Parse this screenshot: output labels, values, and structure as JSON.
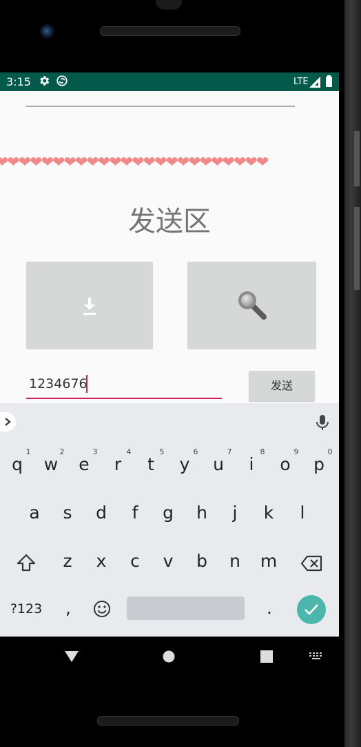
{
  "status_bar": {
    "time": "3:15",
    "network": "LTE"
  },
  "app": {
    "decoration": "❤❤❤❤❤❤❤❤❤❤❤❤❤❤❤❤❤❤❤❤❤❤❤❤",
    "title": "发送区",
    "input": {
      "value": "1234676"
    },
    "send_label": "发送",
    "buttons": {
      "download_icon": "download-icon",
      "search_icon": "search-icon"
    }
  },
  "keyboard": {
    "row1": [
      "q",
      "w",
      "e",
      "r",
      "t",
      "y",
      "u",
      "i",
      "o",
      "p"
    ],
    "row1_hints": [
      "1",
      "2",
      "3",
      "4",
      "5",
      "6",
      "7",
      "8",
      "9",
      "0"
    ],
    "row2": [
      "a",
      "s",
      "d",
      "f",
      "g",
      "h",
      "j",
      "k",
      "l"
    ],
    "row3": [
      "z",
      "x",
      "c",
      "v",
      "b",
      "n",
      "m"
    ],
    "symbols_label": "?123",
    "comma": ",",
    "period": ".",
    "emoji_icon": "emoji-icon",
    "enter_icon": "checkmark-icon"
  },
  "nav_bar": {
    "back_icon": "back-icon",
    "home_icon": "home-icon",
    "recents_icon": "recents-icon",
    "keyboard_switch_icon": "keyboard-icon"
  },
  "colors": {
    "status_bar": "#035a4b",
    "accent": "#d81b60",
    "enter_key": "#4db6ac",
    "hearts": "#f08888"
  }
}
